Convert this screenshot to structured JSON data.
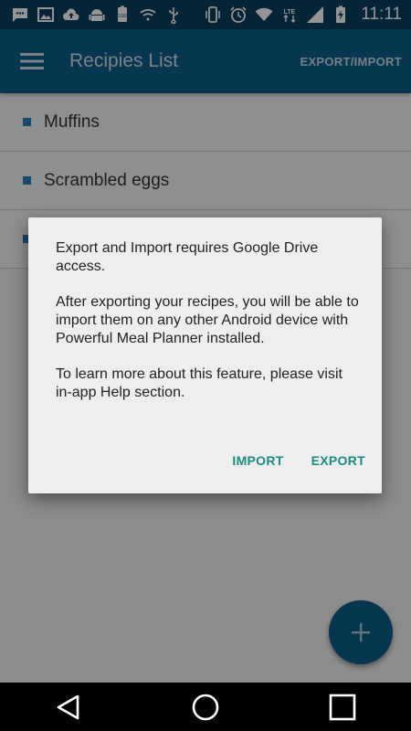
{
  "status_bar": {
    "time": "11:11",
    "battery_badge": "100",
    "network_label": "LTE",
    "left_icons": [
      "message-icon",
      "image-icon",
      "cloud-upload-icon",
      "android-icon",
      "battery-100-icon",
      "wifi-question-icon",
      "usb-icon"
    ],
    "right_icons": [
      "phone-vibrate-icon",
      "alarm-icon",
      "wifi-icon",
      "lte-icon",
      "signal-icon",
      "battery-charging-icon"
    ]
  },
  "app_bar": {
    "title": "Recipies List",
    "action_label": "EXPORT/IMPORT",
    "menu_icon": "menu-icon"
  },
  "recipes": [
    {
      "name": "Muffins"
    },
    {
      "name": "Scrambled eggs"
    },
    {
      "name": ""
    }
  ],
  "dialog": {
    "paragraphs": [
      "Export and Import requires Google Drive access.",
      "After exporting your recipes, you will be able to import them on any other Android device with Powerful Meal Planner installed.",
      "To learn more about this feature, please visit in-app Help section."
    ],
    "import_label": "IMPORT",
    "export_label": "EXPORT"
  },
  "fab": {
    "icon": "plus-icon"
  },
  "nav_bar": {
    "icons": [
      "back-icon",
      "home-icon",
      "recents-icon"
    ]
  },
  "colors": {
    "status_bar": "#0a3f5e",
    "app_bar": "#0d5d8c",
    "accent": "#1c8a7e",
    "bullet": "#2c7bb6"
  }
}
